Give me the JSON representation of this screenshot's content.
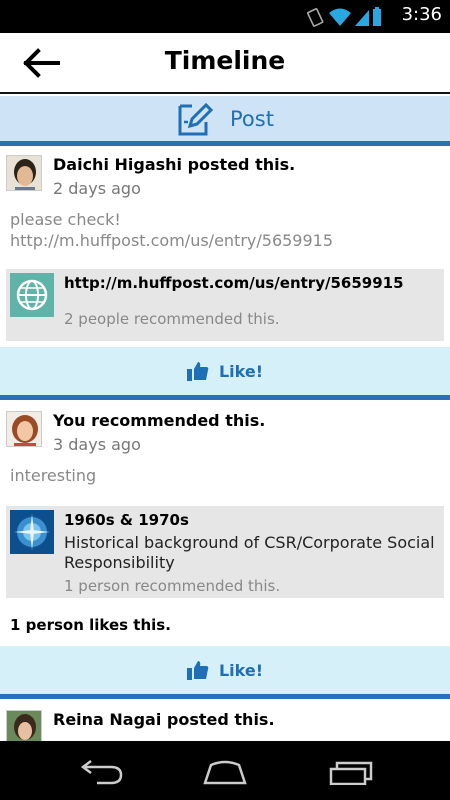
{
  "status_bar": {
    "time": "3:36"
  },
  "app_bar": {
    "title": "Timeline"
  },
  "post_bar": {
    "label": "Post"
  },
  "feed": [
    {
      "author": "Daichi Higashi posted this.",
      "time_ago": "2 days ago",
      "message_line1": "please check!",
      "message_line2": "http://m.huffpost.com/us/entry/5659915",
      "link_title": "http://m.huffpost.com/us/entry/5659915",
      "link_recommended": "2 people recommended this.",
      "like_label": "Like!"
    },
    {
      "author": "You recommended this.",
      "time_ago": "3 days ago",
      "message": "interesting",
      "link_title": "1960s & 1970s",
      "link_description": "Historical background of CSR/Corporate Social Responsibility",
      "link_recommended": "1 person recommended this.",
      "likes_count": "1 person likes this.",
      "like_label": "Like!"
    },
    {
      "author": "Reina Nagai posted this."
    }
  ]
}
